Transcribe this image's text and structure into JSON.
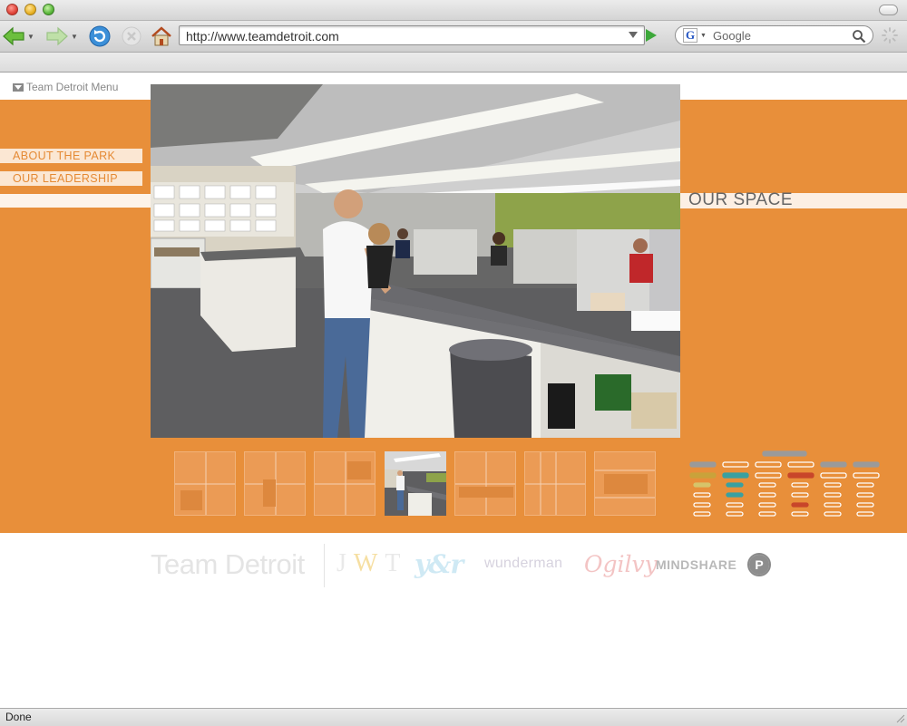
{
  "browser": {
    "url": "http://www.teamdetroit.com",
    "search_placeholder": "Google",
    "search_engine_icon": "G",
    "status": "Done"
  },
  "page": {
    "menu_label": "Team Detroit Menu",
    "nav": {
      "about": "ABOUT THE PARK",
      "leadership": "OUR LEADERSHIP"
    },
    "section_title": "OUR SPACE",
    "selected_thumbnail": 4,
    "thumbnail_count": 7
  },
  "footer": {
    "team_detroit": "Team Detroit",
    "jwt": "JWT",
    "yr": "y&r",
    "wunderman": "wunderman",
    "ogilvy": "Ogilvy",
    "mindshare": "MINDSHARE",
    "p_logo": "P"
  },
  "colors": {
    "brand_orange": "#e88f3a",
    "tab_bg": "#fbe7d3",
    "tab_text": "#e58a34",
    "status_go": "#3da83a"
  },
  "icons": [
    "back-arrow-icon",
    "forward-arrow-icon",
    "reload-icon",
    "stop-icon",
    "home-icon",
    "search-icon",
    "spinner-icon",
    "menu-triangle-icon"
  ]
}
